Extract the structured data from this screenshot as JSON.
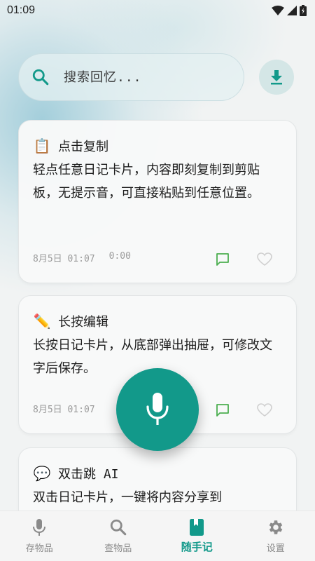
{
  "status": {
    "time": "01:09"
  },
  "search": {
    "placeholder": "搜索回忆..."
  },
  "cards": [
    {
      "emoji": "📋",
      "title": "点击复制",
      "body": "轻点任意日记卡片，内容即刻复制到剪贴板，无提示音，可直接粘贴到任意位置。",
      "date": "8月5日 01:07",
      "duration": "0:00"
    },
    {
      "emoji": "✏️",
      "title": "长按编辑",
      "body": "长按日记卡片，从底部弹出抽屉，可修改文字后保存。",
      "date": "8月5日 01:07",
      "duration": ""
    },
    {
      "emoji": "💬",
      "title": "双击跳 AI",
      "body": "双击日记卡片，一键将内容分享到",
      "date": "",
      "duration": ""
    }
  ],
  "nav": [
    {
      "label": "存物品",
      "icon": "mic-icon"
    },
    {
      "label": "查物品",
      "icon": "search-icon"
    },
    {
      "label": "随手记",
      "icon": "book-icon"
    },
    {
      "label": "设置",
      "icon": "gear-icon"
    }
  ],
  "colors": {
    "accent": "#12998a",
    "comment_icon": "#4caf50",
    "heart_icon": "#d0d0d0"
  }
}
